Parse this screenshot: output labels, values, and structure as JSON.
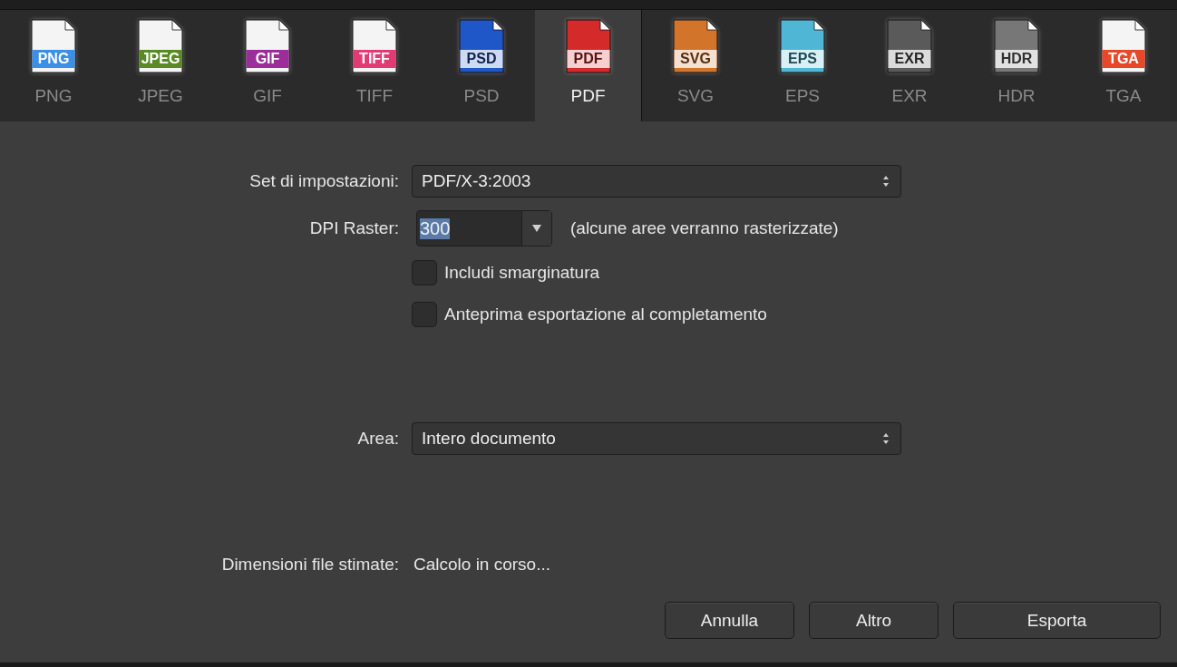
{
  "formats": [
    {
      "label": "PNG",
      "icon_text": "PNG",
      "kind": "light",
      "color": "#3b8fe6",
      "selected": false
    },
    {
      "label": "JPEG",
      "icon_text": "JPEG",
      "kind": "light",
      "color": "#5a8a25",
      "selected": false
    },
    {
      "label": "GIF",
      "icon_text": "GIF",
      "kind": "light",
      "color": "#9b2e9b",
      "selected": false
    },
    {
      "label": "TIFF",
      "icon_text": "TIFF",
      "kind": "light",
      "color": "#e23a72",
      "selected": false
    },
    {
      "label": "PSD",
      "icon_text": "PSD",
      "kind": "dark",
      "color": "#1f56c8",
      "selected": false
    },
    {
      "label": "PDF",
      "icon_text": "PDF",
      "kind": "dark",
      "color": "#d42a2a",
      "selected": true
    },
    {
      "label": "SVG",
      "icon_text": "SVG",
      "kind": "dark",
      "color": "#d2742a",
      "selected": false
    },
    {
      "label": "EPS",
      "icon_text": "EPS",
      "kind": "dark",
      "color": "#4fb6d6",
      "selected": false
    },
    {
      "label": "EXR",
      "icon_text": "EXR",
      "kind": "dark",
      "color": "#5a5a5a",
      "selected": false
    },
    {
      "label": "HDR",
      "icon_text": "HDR",
      "kind": "dark",
      "color": "#777777",
      "selected": false
    },
    {
      "label": "TGA",
      "icon_text": "TGA",
      "kind": "light",
      "color": "#e8482a",
      "selected": false
    }
  ],
  "preset": {
    "label": "Set di impostazioni:",
    "value": "PDF/X-3:2003"
  },
  "dpi": {
    "label": "DPI Raster:",
    "value": "300",
    "text_selected": true,
    "note": "(alcune aree verranno rasterizzate)"
  },
  "options": [
    {
      "label": "Includi smarginatura",
      "checked": false
    },
    {
      "label": "Anteprima esportazione al completamento",
      "checked": false
    }
  ],
  "area": {
    "label": "Area:",
    "value": "Intero documento"
  },
  "estimate": {
    "label": "Dimensioni file stimate:",
    "value": "Calcolo in corso..."
  },
  "buttons": [
    {
      "label": "Annulla"
    },
    {
      "label": "Altro"
    },
    {
      "label": "Esporta"
    }
  ]
}
